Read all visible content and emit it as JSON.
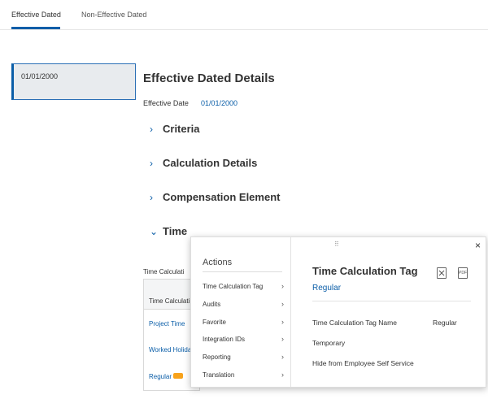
{
  "tabs": {
    "effective_dated": "Effective Dated",
    "non_effective_dated": "Non-Effective Dated"
  },
  "date_list": [
    "01/01/2000"
  ],
  "details": {
    "title": "Effective Dated Details",
    "effective_date_label": "Effective Date",
    "effective_date_value": "01/01/2000"
  },
  "sections": [
    {
      "label": "Criteria",
      "expanded": false
    },
    {
      "label": "Calculation Details",
      "expanded": false
    },
    {
      "label": "Compensation Element",
      "expanded": false
    },
    {
      "label": "Time",
      "expanded": true
    }
  ],
  "time_section": {
    "grid_label": "Time Calculati",
    "column_header": "Time Calculati",
    "rows": [
      "Project Time",
      "Worked Holida",
      "Regular"
    ]
  },
  "popup": {
    "actions_title": "Actions",
    "menu": [
      "Time Calculation Tag",
      "Audits",
      "Favorite",
      "Integration IDs",
      "Reporting",
      "Translation"
    ],
    "drag_handle": "⠿",
    "close": "×",
    "heading": "Time Calculation Tag",
    "subheading": "Regular",
    "excel_icon": "excel-export-icon",
    "pdf_icon": "pdf-export-icon",
    "pdf_text": "PDF",
    "fields": [
      {
        "label": "Time Calculation Tag Name",
        "value": "Regular"
      },
      {
        "label": "Temporary",
        "value": ""
      },
      {
        "label": "Hide from Employee Self Service",
        "value": ""
      }
    ]
  },
  "colors": {
    "accent": "#0b5ea8",
    "related_actions": "#f7a21b"
  }
}
